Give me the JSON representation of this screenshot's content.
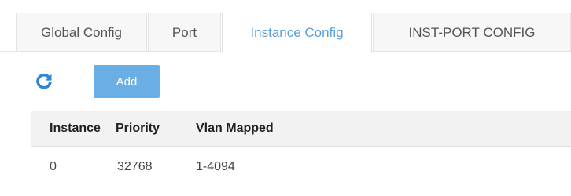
{
  "tabs": [
    {
      "label": "Global Config",
      "active": false
    },
    {
      "label": "Port",
      "active": false
    },
    {
      "label": "Instance Config",
      "active": true
    },
    {
      "label": "INST-PORT CONFIG",
      "active": false
    }
  ],
  "toolbar": {
    "refresh_icon": "refresh-icon",
    "add_label": "Add"
  },
  "table": {
    "columns": [
      "Instance",
      "Priority",
      "Vlan Mapped"
    ],
    "rows": [
      {
        "instance": "0",
        "priority": "32768",
        "vlan_mapped": "1-4094"
      }
    ]
  },
  "colors": {
    "accent": "#5a9fdb",
    "button": "#69aee5",
    "header_bg": "#f2f2f2"
  }
}
